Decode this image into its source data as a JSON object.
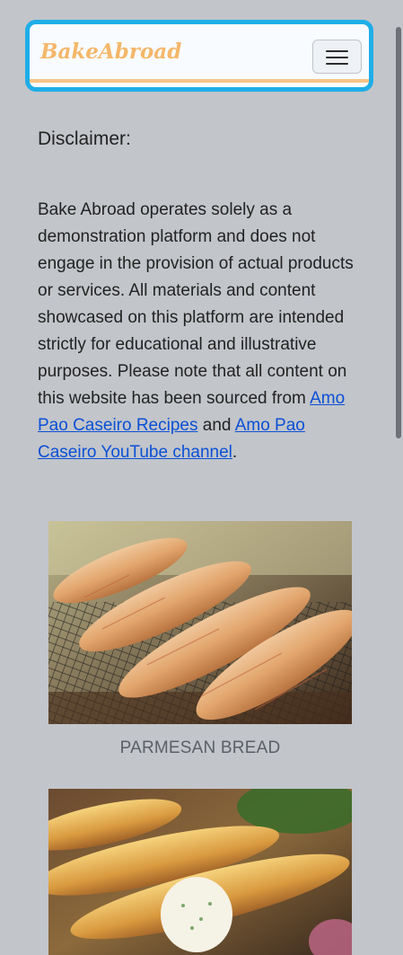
{
  "navbar": {
    "brand": "BakeAbroad",
    "toggler_icon": "hamburger-menu-icon",
    "border_color": "#1eaee8",
    "brand_color": "#f4b76a"
  },
  "disclaimer": {
    "title": "Disclaimer:",
    "body": "Bake Abroad operates solely as a demonstration platform and does not engage in the provision of actual products or services. All materials and content showcased on this platform are intended strictly for educational and illustrative purposes. Please note that all content on this website has been sourced from ",
    "link1": "Amo Pao Caseiro Recipes",
    "joiner": "and",
    "link2": "Amo Pao Caseiro YouTube channel",
    "end": "."
  },
  "recipes": [
    {
      "caption": "PARMESAN BREAD"
    },
    {
      "caption": ""
    }
  ]
}
